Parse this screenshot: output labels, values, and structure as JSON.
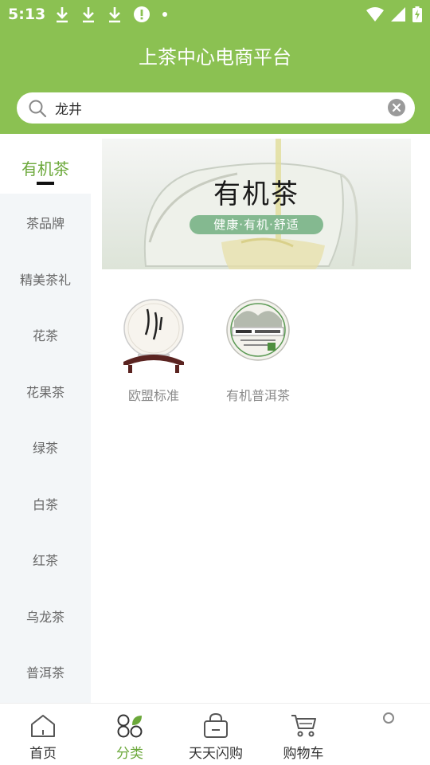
{
  "status_bar": {
    "time": "5:13"
  },
  "header": {
    "title": "上茶中心电商平台"
  },
  "search": {
    "value": "龙井"
  },
  "sidebar": {
    "items": [
      {
        "label": "有机茶",
        "active": true
      },
      {
        "label": "茶品牌"
      },
      {
        "label": "精美茶礼"
      },
      {
        "label": "花茶"
      },
      {
        "label": "花果茶"
      },
      {
        "label": "绿茶"
      },
      {
        "label": "白茶"
      },
      {
        "label": "红茶"
      },
      {
        "label": "乌龙茶"
      },
      {
        "label": "普洱茶"
      }
    ]
  },
  "banner": {
    "title": "有机茶",
    "subtitle": "健康·有机·舒适"
  },
  "products": [
    {
      "name": "欧盟标准"
    },
    {
      "name": "有机普洱茶"
    }
  ],
  "tabbar": {
    "items": [
      {
        "label": "首页",
        "icon": "home-icon"
      },
      {
        "label": "分类",
        "icon": "category-icon",
        "active": true
      },
      {
        "label": "天天闪购",
        "icon": "flash-sale-bag-icon"
      },
      {
        "label": "购物车",
        "icon": "cart-icon"
      }
    ]
  },
  "colors": {
    "brand_green": "#8bc152",
    "active_green": "#6ba83a",
    "sidebar_bg": "#f3f6f8"
  }
}
